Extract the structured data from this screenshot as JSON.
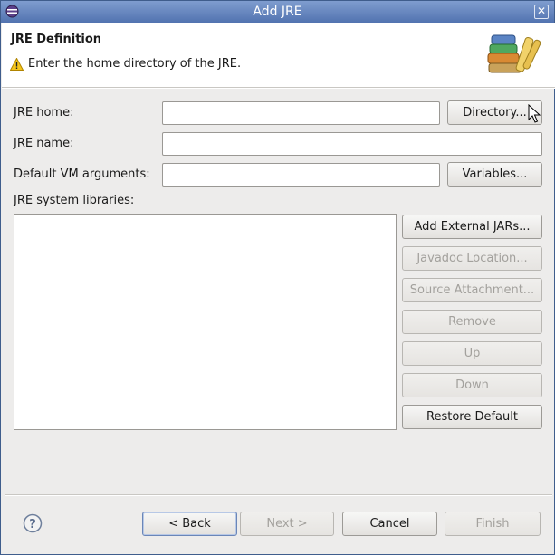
{
  "window": {
    "title": "Add JRE"
  },
  "header": {
    "title": "JRE Definition",
    "message": "Enter the home directory of the JRE.",
    "message_icon": "warning-icon",
    "banner_icon": "books-icon"
  },
  "form": {
    "jre_home_label": "JRE home:",
    "jre_home_value": "",
    "jre_name_label": "JRE name:",
    "jre_name_value": "",
    "vm_args_label": "Default VM arguments:",
    "vm_args_value": "",
    "directory_button": "Directory...",
    "variables_button": "Variables...",
    "system_libraries_label": "JRE system libraries:",
    "system_libraries": []
  },
  "library_buttons": {
    "add_external_jars": "Add External JARs...",
    "javadoc_location": "Javadoc Location...",
    "source_attachment": "Source Attachment...",
    "remove": "Remove",
    "up": "Up",
    "down": "Down",
    "restore_default": "Restore Default"
  },
  "footer": {
    "help_icon": "help-icon",
    "back_button": "< Back",
    "next_button": "Next >",
    "cancel_button": "Cancel",
    "finish_button": "Finish"
  },
  "colors": {
    "titlebar": "#5f80bd",
    "dialog_bg": "#edeceb",
    "disabled_text": "#a3a19d"
  }
}
